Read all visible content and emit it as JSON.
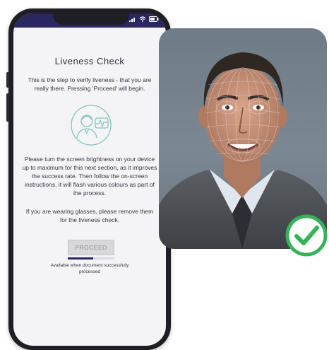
{
  "screen": {
    "title": "Liveness Check",
    "intro": "This is the step to verify liveness - that you are really there. Pressing 'Proceed' will begin.",
    "instructions": "Please turn the screen brightness on your device up to maximum for this next section, as it improves the success rate. Then follow the on-screen instructions, it will flash various colours as part of the process.",
    "glasses_note": "If you are wearing glasses, please remove them for the liveness check.",
    "proceed_label": "PROCEED",
    "availability_note": "Available when document successfully processed",
    "upload_progress": 0.55
  },
  "status_icons": [
    "signal-icon",
    "wifi-icon",
    "battery-icon"
  ],
  "colors": {
    "status_bar": "#2a2760",
    "illustration": "#7fc4bd",
    "check": "#35b35a",
    "button_disabled": "#d7d7dc"
  },
  "icons": {
    "illustration": "person-heartbeat-icon",
    "verified": "checkmark-circle-icon"
  }
}
